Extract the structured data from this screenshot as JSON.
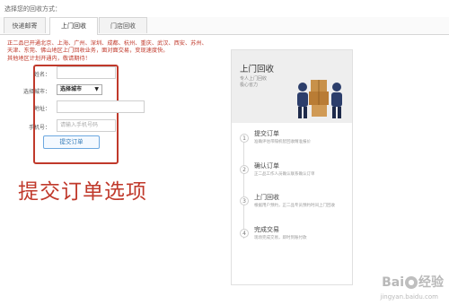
{
  "page": {
    "label": "选择您的回收方式："
  },
  "tabs": [
    {
      "label": "快递邮寄"
    },
    {
      "label": "上门回收"
    },
    {
      "label": "门店回收"
    }
  ],
  "notice": {
    "lines": [
      "正二品已开通北京、上海、广州、深圳、成都、杭州、重庆、武汉、西安、苏州、",
      "天津、东莞、佛山地区上门回收业务，面对面交易，变现速度快。",
      "其他地区计划开通内，敬请期待！"
    ]
  },
  "form": {
    "name_label": "姓名：",
    "city_label": "选择城市：",
    "city_value": "选择城市",
    "address_label": "地址：",
    "phone_label": "手机号：",
    "phone_placeholder": "请输入手机号码",
    "submit_label": "提交订单"
  },
  "caption": {
    "text": "提交订单选项"
  },
  "panel": {
    "title": "上门回收",
    "subtitle_1": "专人上门回收",
    "subtitle_2": "极心省力",
    "steps": [
      {
        "num": "1",
        "title": "提交订单",
        "desc": "准确评估带隔机智回收精准报价"
      },
      {
        "num": "2",
        "title": "确认订单",
        "desc": "正二品工作人员确认联系确认订单"
      },
      {
        "num": "3",
        "title": "上门回收",
        "desc": "根据用户预约，正二品专员预约时间上门回收"
      },
      {
        "num": "4",
        "title": "完成交易",
        "desc": "现场完成交易，即时到账付款"
      }
    ]
  },
  "watermark": {
    "brand_left": "Bai",
    "brand_right": "经验",
    "url": "jingyan.baidu.com"
  },
  "colors": {
    "accent": "#c0392b",
    "link": "#337ab7"
  }
}
